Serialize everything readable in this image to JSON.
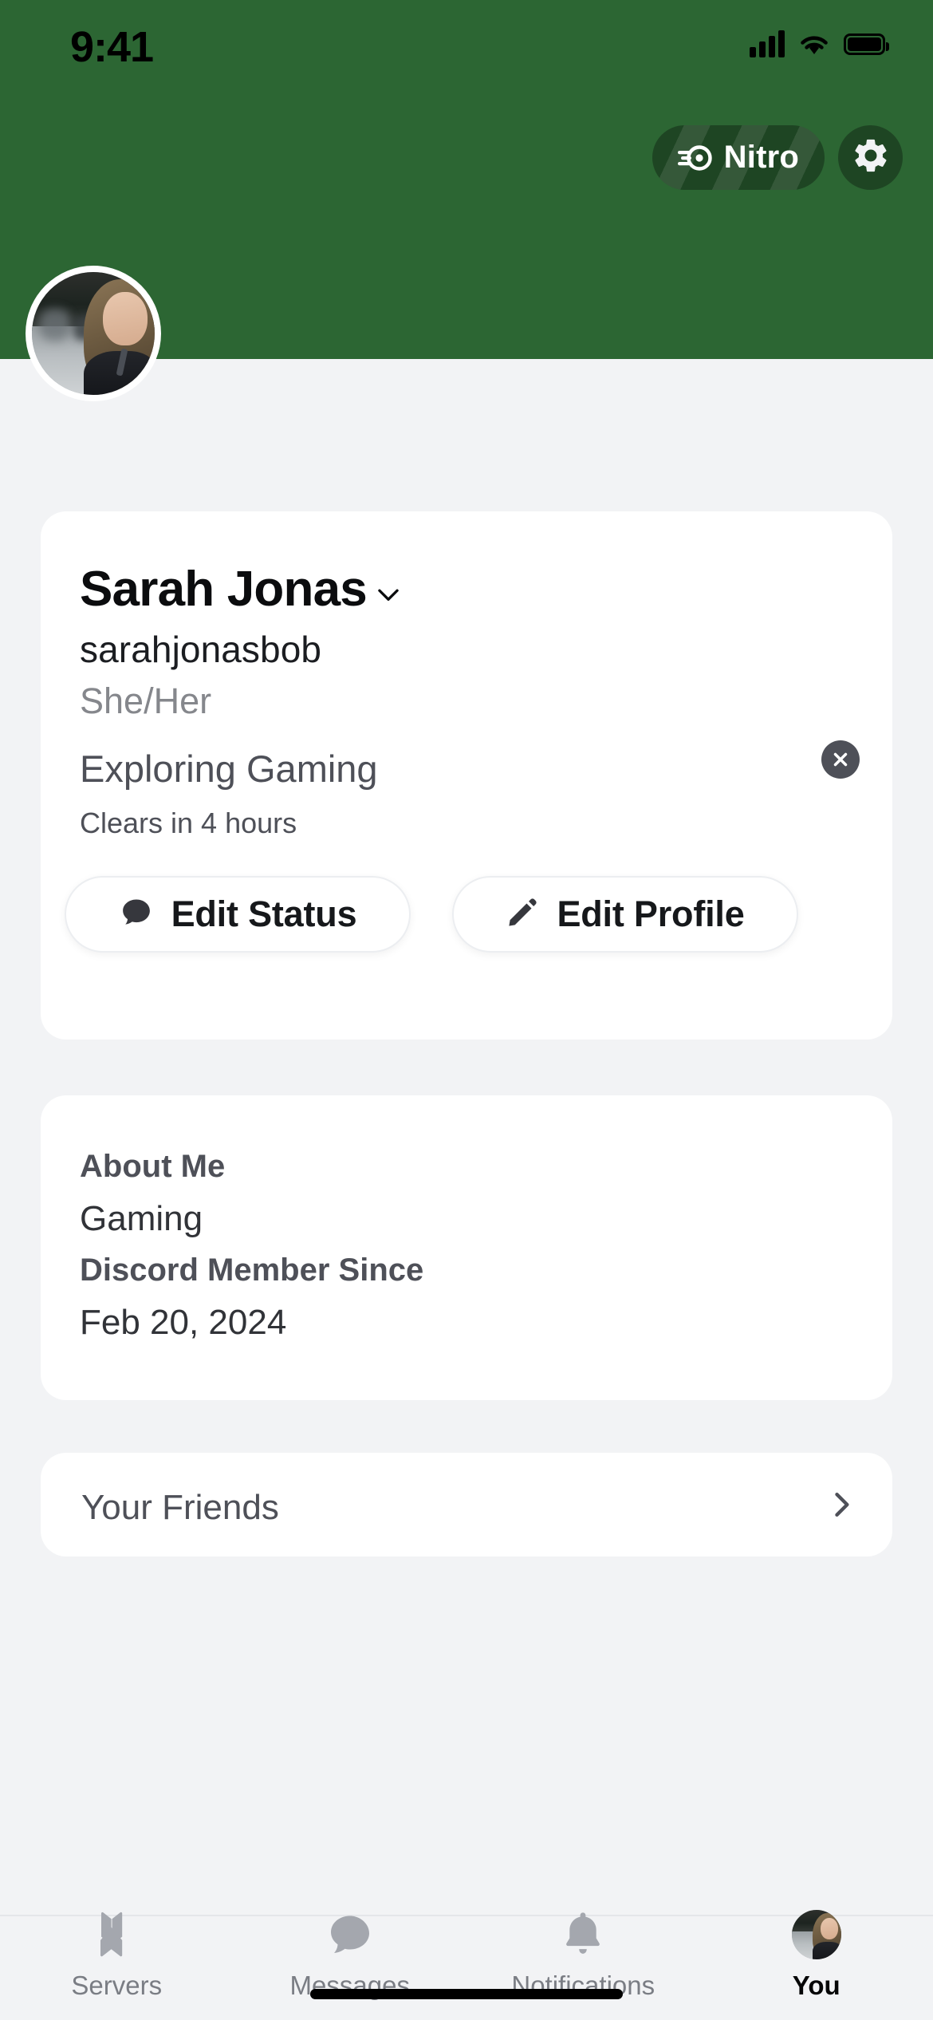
{
  "status_bar": {
    "time": "9:41",
    "cellular_icon": "signal-bars-icon",
    "wifi_icon": "wifi-icon",
    "battery_icon": "battery-icon"
  },
  "header": {
    "background_color": "#2c6633",
    "nitro_button": {
      "label": "Nitro",
      "icon": "nitro-wheel-icon",
      "background_color": "#1e4523"
    },
    "settings_button": {
      "icon": "gear-icon",
      "background_color": "#1e4523"
    },
    "avatar": {
      "icon": "user-avatar",
      "ring_color": "#ffffff"
    }
  },
  "profile": {
    "display_name": "Sarah Jonas",
    "name_chevron_icon": "chevron-down-icon",
    "username": "sarahjonasbob",
    "pronouns": "She/Her",
    "custom_status": "Exploring Gaming",
    "status_expiry": "Clears in 4 hours",
    "clear_status_icon": "close-circle-icon",
    "clear_status_color": "#4e5058",
    "buttons": [
      {
        "label": "Edit Status",
        "icon": "speech-bubble-icon"
      },
      {
        "label": "Edit Profile",
        "icon": "pencil-icon"
      }
    ]
  },
  "about": {
    "about_me_title": "About Me",
    "about_me_value": "Gaming",
    "member_since_title": "Discord Member Since",
    "member_since_value": "Feb 20, 2024"
  },
  "friends": {
    "label": "Your Friends",
    "chevron_icon": "chevron-right-icon"
  },
  "tab_bar": {
    "items": [
      {
        "label": "Servers",
        "icon": "servers-icon",
        "active": false
      },
      {
        "label": "Messages",
        "icon": "speech-bubble-icon",
        "active": false
      },
      {
        "label": "Notifications",
        "icon": "bell-icon",
        "active": false
      },
      {
        "label": "You",
        "icon": "user-avatar-icon",
        "active": true
      }
    ],
    "inactive_color": "#7a7d84",
    "active_color": "#060607"
  },
  "theme": {
    "page_background": "#f2f3f5",
    "card_background": "#ffffff",
    "accent_green": "#2c6633",
    "text_primary": "#313338",
    "text_secondary": "#4e5058",
    "text_muted": "#85878c"
  }
}
